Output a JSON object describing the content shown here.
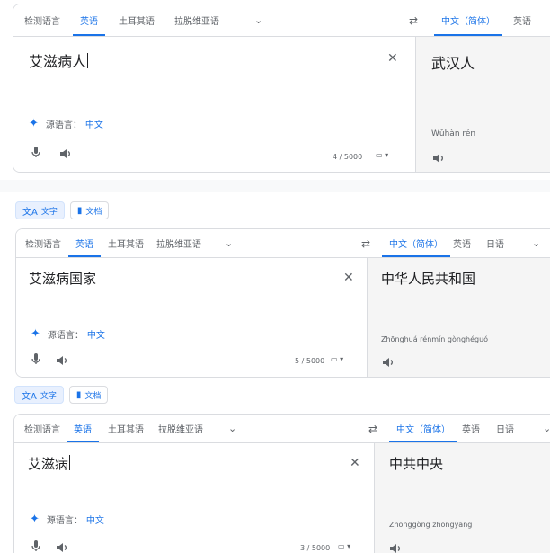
{
  "panel1": {
    "source_langs": [
      "检测语言",
      "英语",
      "土耳其语",
      "拉脱维亚语"
    ],
    "target_langs": [
      "中文（简体）",
      "英语"
    ],
    "source_text": "艾滋病人",
    "detected_label": "源语言：",
    "detected_lang": "中文",
    "char_count": "4 / 5000",
    "translation": "武汉人",
    "pinyin": "Wǔhàn rén"
  },
  "modes": {
    "text": "文字",
    "docs": "文档"
  },
  "panel2": {
    "source_langs": [
      "检测语言",
      "英语",
      "土耳其语",
      "拉脱维亚语"
    ],
    "target_langs": [
      "中文（简体）",
      "英语",
      "日语"
    ],
    "source_text": "艾滋病国家",
    "detected_label": "源语言：",
    "detected_lang": "中文",
    "char_count": "5 / 5000",
    "translation": "中华人民共和国",
    "pinyin": "Zhōnghuá rénmín gònghéguó"
  },
  "panel3": {
    "source_langs": [
      "检测语言",
      "英语",
      "土耳其语",
      "拉脱维亚语"
    ],
    "target_langs": [
      "中文（简体）",
      "英语",
      "日语"
    ],
    "source_text": "艾滋病",
    "detected_label": "源语言：",
    "detected_lang": "中文",
    "char_count": "3 / 5000",
    "translation": "中共中央",
    "pinyin": "Zhōnggòng zhōngyāng"
  },
  "icons": {
    "swap": "swap-icon",
    "close": "close-icon",
    "sparkle": "sparkle-icon",
    "mic": "mic-icon",
    "speaker": "speaker-icon",
    "keyboard": "keyboard-icon",
    "chevron": "chevron-down-icon",
    "translate": "translate-icon",
    "document": "document-icon"
  },
  "colors": {
    "accent": "#1a73e8",
    "border": "#dadce0",
    "target_bg": "#f5f5f5"
  }
}
